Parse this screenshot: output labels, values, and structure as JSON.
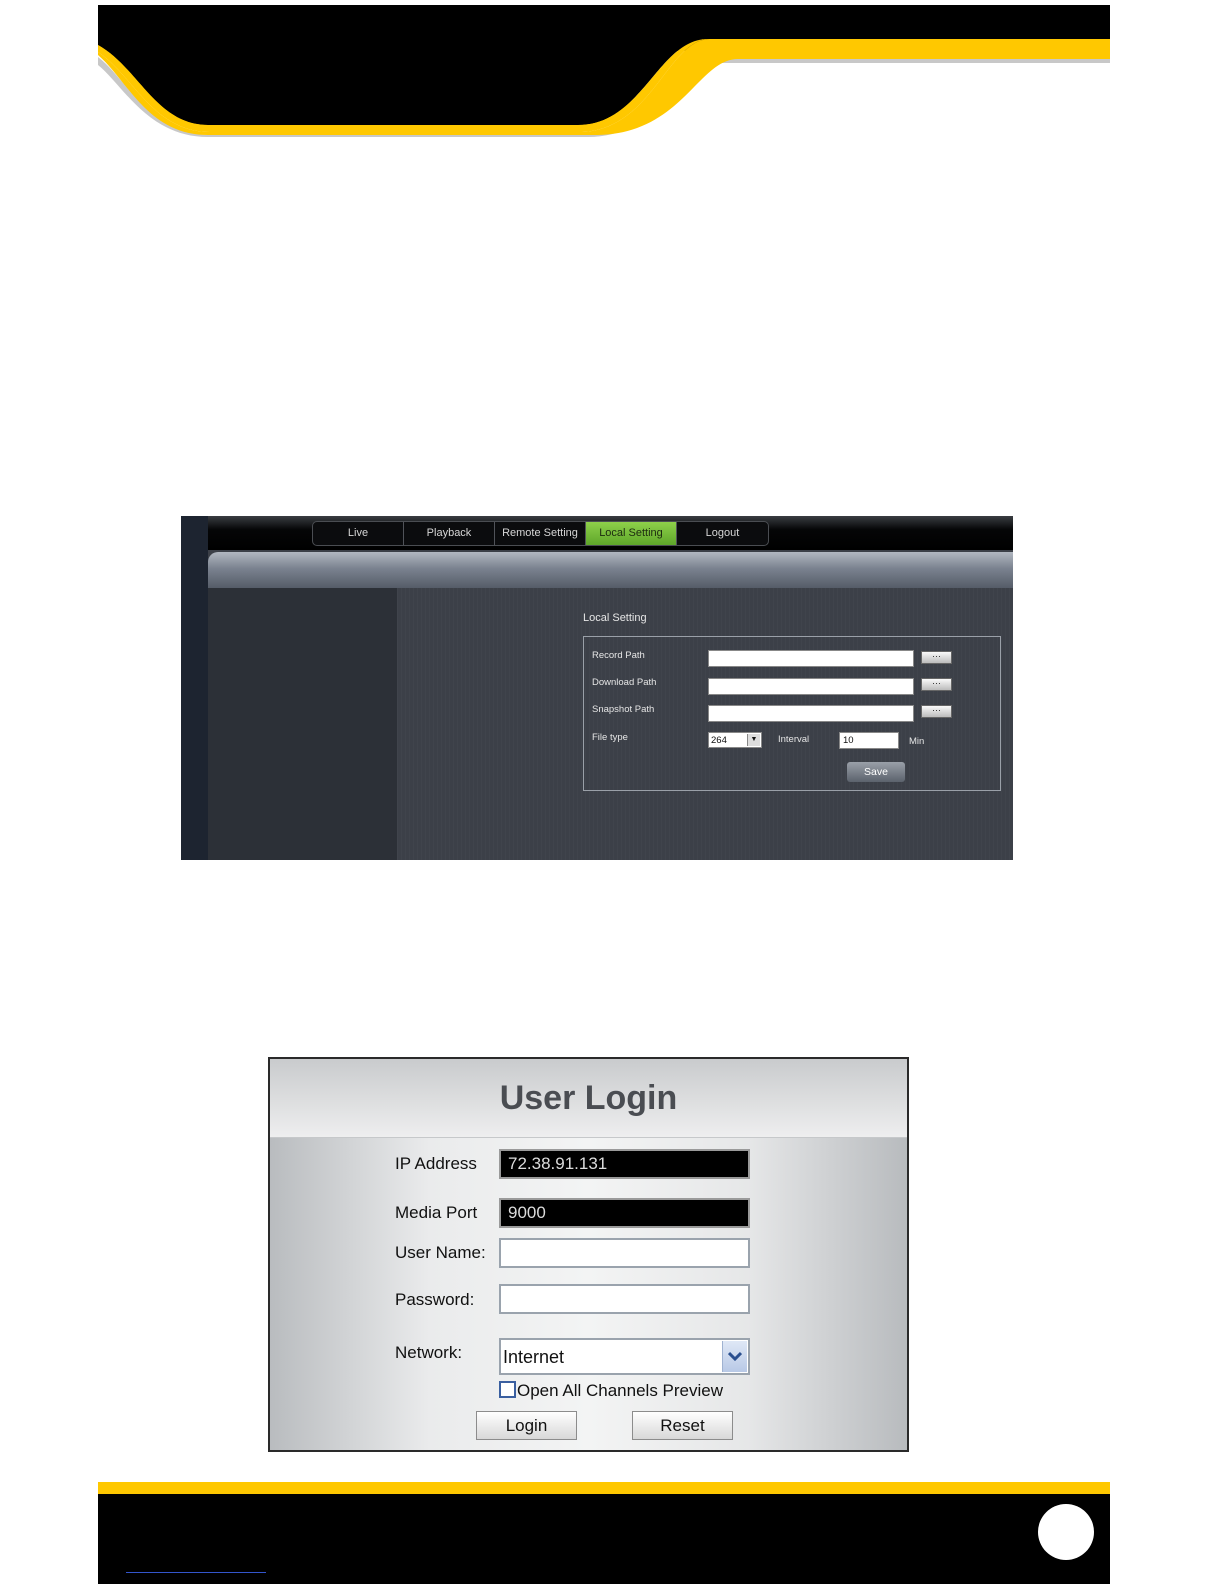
{
  "colors": {
    "brand_yellow": "#ffc800",
    "brand_black": "#000000",
    "active_tab_green": "#6bb632"
  },
  "local_setting_screen": {
    "tabs": [
      {
        "label": "Live"
      },
      {
        "label": "Playback"
      },
      {
        "label": "Remote Setting"
      },
      {
        "label": "Local Setting",
        "active": true
      },
      {
        "label": "Logout"
      }
    ],
    "section_title": "Local Setting",
    "record_path_label": "Record Path",
    "download_path_label": "Download Path",
    "snapshot_path_label": "Snapshot Path",
    "browse_label": "···",
    "file_type_label": "File type",
    "file_type_value": "264",
    "interval_label": "Interval",
    "interval_value": "10",
    "interval_unit": "Min",
    "save_label": "Save"
  },
  "user_login_screen": {
    "title": "User Login",
    "ip_address_label": "IP Address",
    "ip_address_value": "72.38.91.131",
    "media_port_label": "Media Port",
    "media_port_value": "9000",
    "user_name_label": "User Name:",
    "password_label": "Password:",
    "network_label": "Network:",
    "network_value": "Internet",
    "open_all_channels_label": "Open All Channels Preview",
    "login_label": "Login",
    "reset_label": "Reset"
  }
}
